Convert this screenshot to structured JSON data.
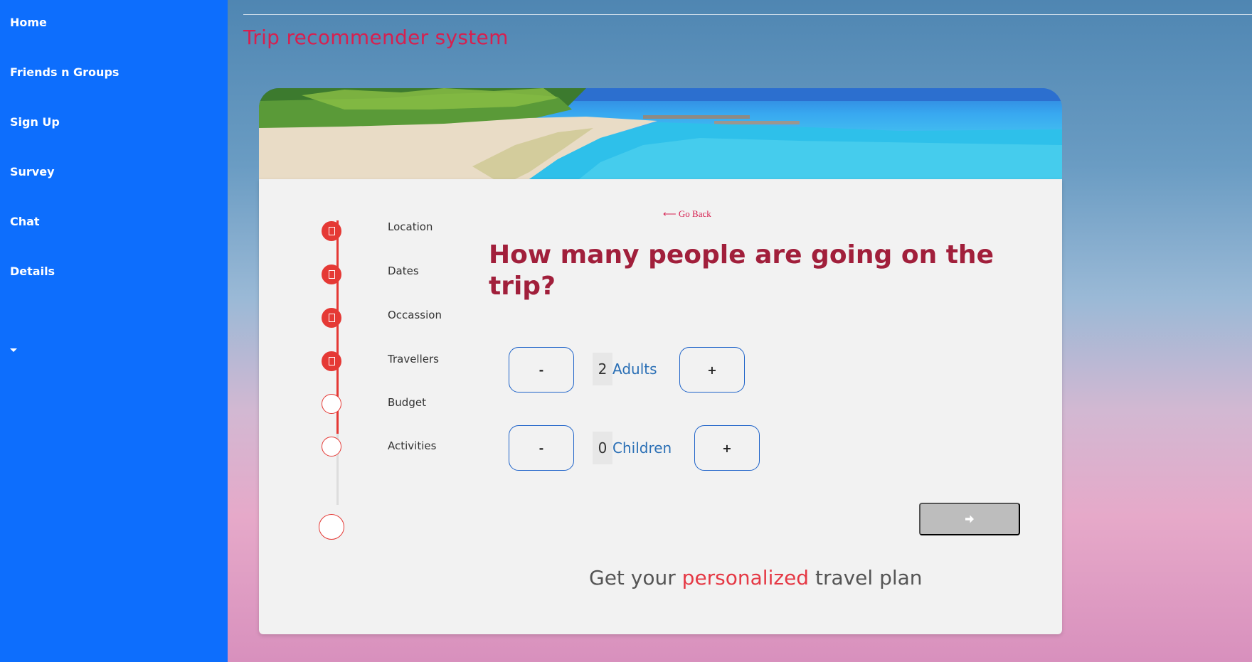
{
  "sidebar": {
    "items": [
      {
        "label": "Home"
      },
      {
        "label": "Friends n Groups"
      },
      {
        "label": "Sign Up"
      },
      {
        "label": "Survey"
      },
      {
        "label": "Chat"
      },
      {
        "label": "Details"
      }
    ]
  },
  "header": {
    "title": "Trip recommender system"
  },
  "steps": [
    {
      "label": "Location",
      "completed": true
    },
    {
      "label": "Dates",
      "completed": true
    },
    {
      "label": "Occassion",
      "completed": true
    },
    {
      "label": "Travellers",
      "completed": true
    },
    {
      "label": "Budget",
      "completed": false
    },
    {
      "label": "Activities",
      "completed": false
    }
  ],
  "main": {
    "go_back": "⟵ Go Back",
    "question": "How many people are going on the trip?",
    "adults": {
      "minus": "-",
      "value": "2",
      "label": "Adults",
      "plus": "+"
    },
    "children": {
      "minus": "-",
      "value": "0",
      "label": "Children",
      "plus": "+"
    },
    "next_icon": "arrow-right-icon"
  },
  "footer": {
    "part1": "Get your ",
    "accent": "personalized",
    "part2": " travel plan"
  },
  "colors": {
    "sidebar": "#0d6efd",
    "title": "#d62050",
    "question": "#a11f3b",
    "step_accent": "#e53935",
    "counter_border": "#1e63c9"
  }
}
